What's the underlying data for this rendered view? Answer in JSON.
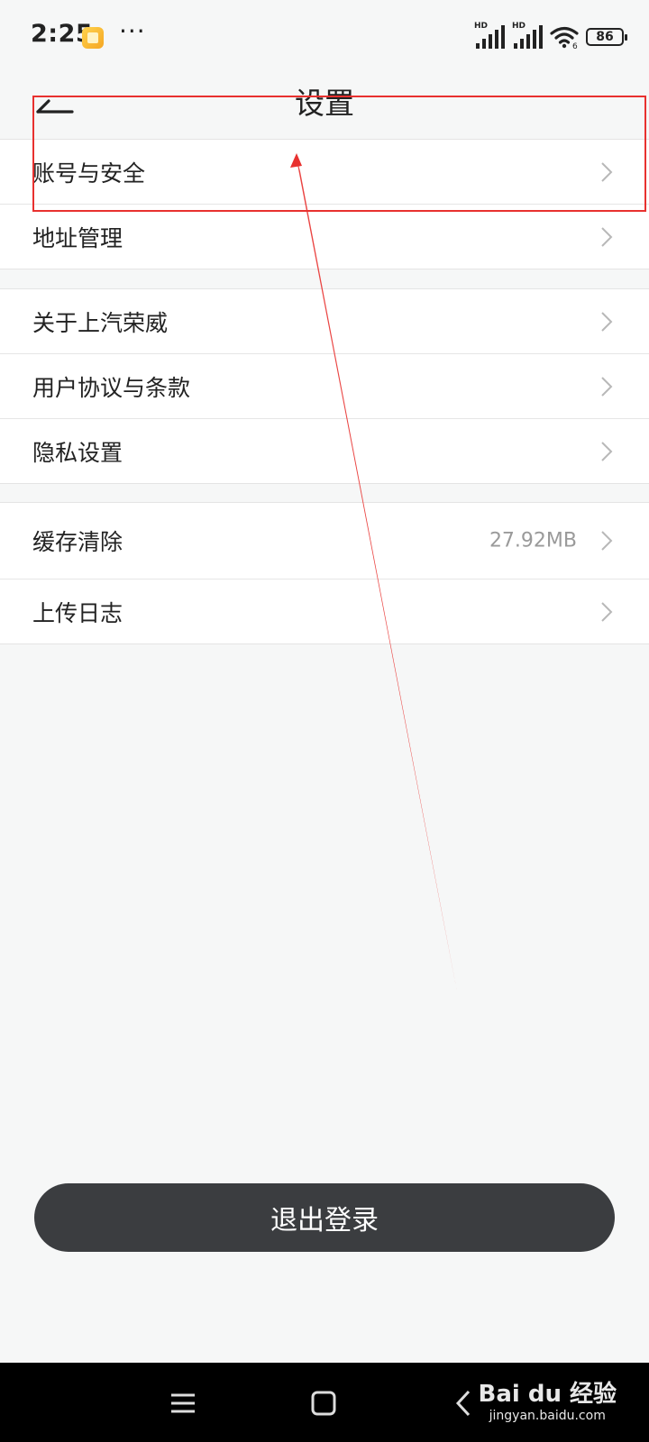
{
  "status_bar": {
    "time": "2:25",
    "more_dots": "···",
    "signal_label_1": "HD",
    "signal_label_2": "HD",
    "wifi_badge": "6",
    "battery": "86",
    "icons": [
      "app-notification-icon",
      "signal-icon",
      "signal-icon",
      "wifi-icon",
      "battery-icon"
    ]
  },
  "header": {
    "title": "设置",
    "back_icon": "arrow-left-icon"
  },
  "groups": [
    {
      "items": [
        {
          "label": "账号与安全"
        },
        {
          "label": "地址管理"
        }
      ]
    },
    {
      "items": [
        {
          "label": "关于上汽荣威"
        },
        {
          "label": "用户协议与条款"
        },
        {
          "label": "隐私设置"
        }
      ]
    },
    {
      "items": [
        {
          "label": "缓存清除",
          "value": "27.92MB"
        },
        {
          "label": "上传日志"
        }
      ]
    }
  ],
  "logout_label": "退出登录",
  "nav_bar": {
    "icons": [
      "menu-icon",
      "home-icon",
      "back-icon"
    ]
  },
  "watermark": {
    "brand": "Bai du 经验",
    "url": "jingyan.baidu.com"
  },
  "colors": {
    "background": "#f6f7f7",
    "button": "#3b3d40",
    "annotation": "#e8312f"
  }
}
